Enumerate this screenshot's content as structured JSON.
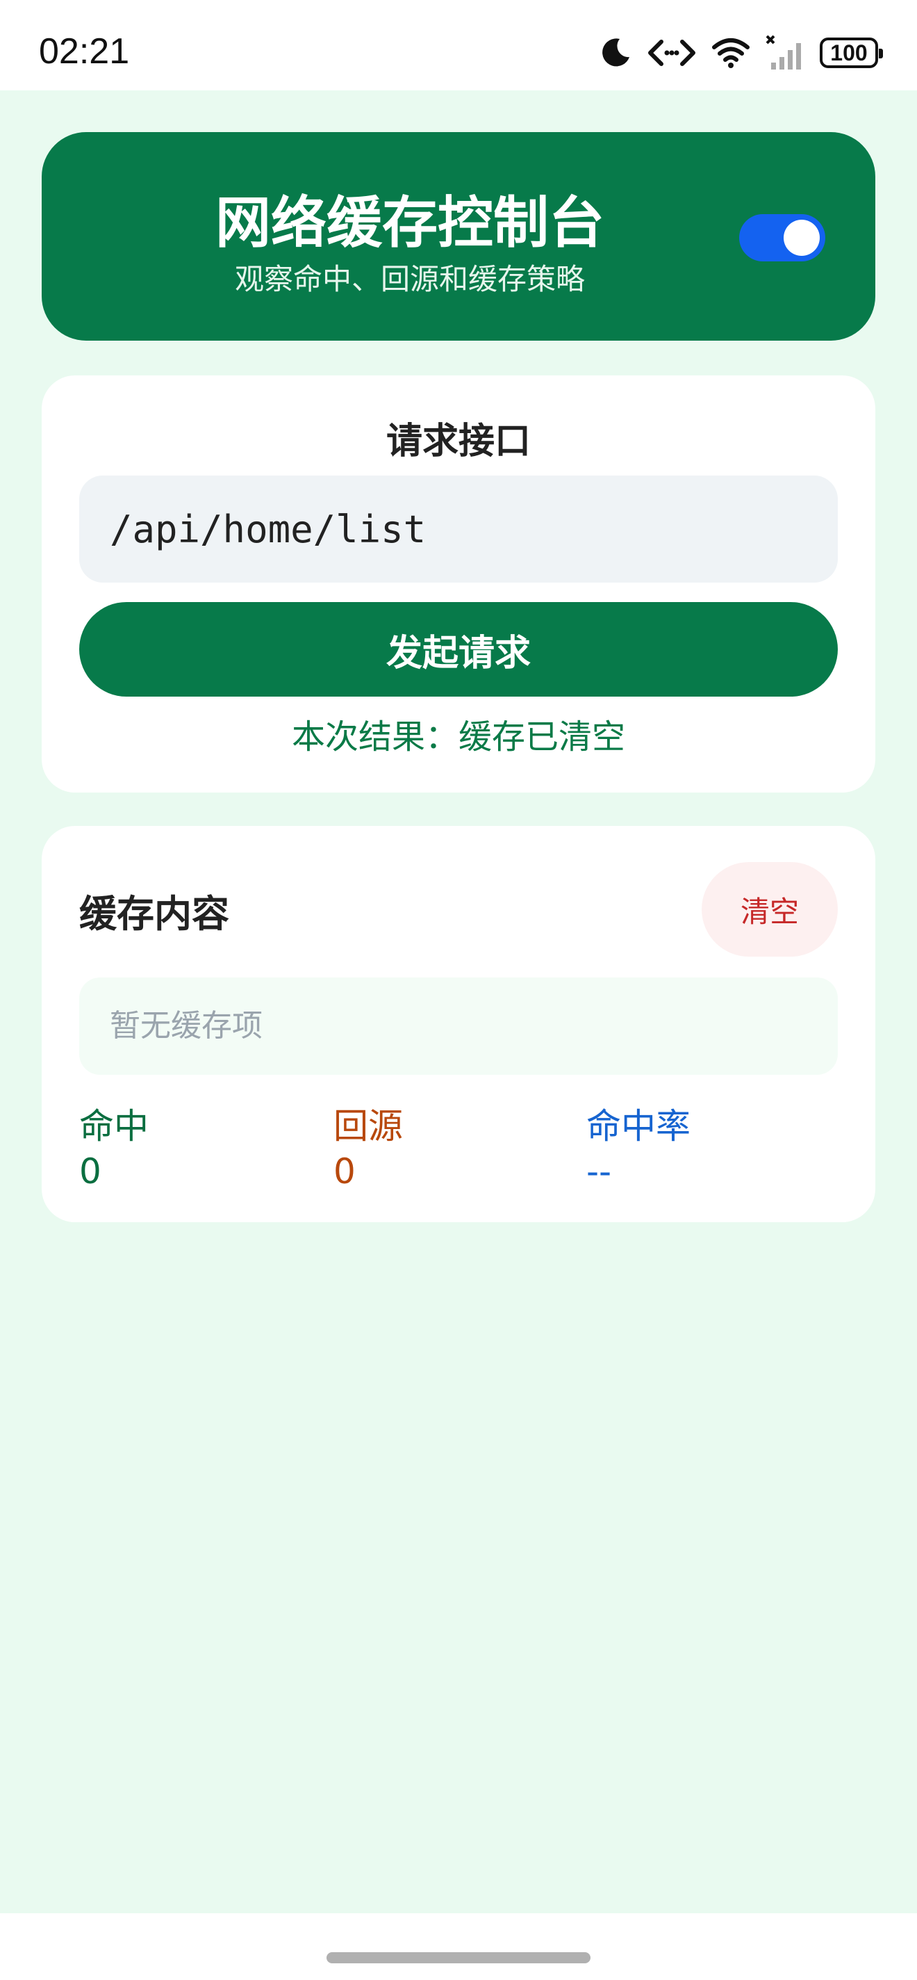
{
  "status_bar": {
    "time": "02:21",
    "battery": "100",
    "icons": [
      "moon-icon",
      "code-arrows-icon",
      "wifi-icon",
      "signal-icon",
      "battery-icon"
    ]
  },
  "hero": {
    "title": "网络缓存控制台",
    "subtitle": "观察命中、回源和缓存策略",
    "toggle_on": true
  },
  "request": {
    "title": "请求接口",
    "endpoint_value": "/api/home/list",
    "send_label": "发起请求",
    "result": "本次结果：缓存已清空"
  },
  "cache": {
    "title": "缓存内容",
    "clear_label": "清空",
    "empty_text": "暂无缓存项",
    "stats": {
      "hit_label": "命中",
      "hit_value": "0",
      "origin_label": "回源",
      "origin_value": "0",
      "rate_label": "命中率",
      "rate_value": "--"
    }
  },
  "colors": {
    "primary": "#077a4a",
    "background": "#e9faf0",
    "toggle": "#1462f0",
    "danger": "#c62828",
    "origin": "#b8480c",
    "rate": "#1664d0"
  }
}
